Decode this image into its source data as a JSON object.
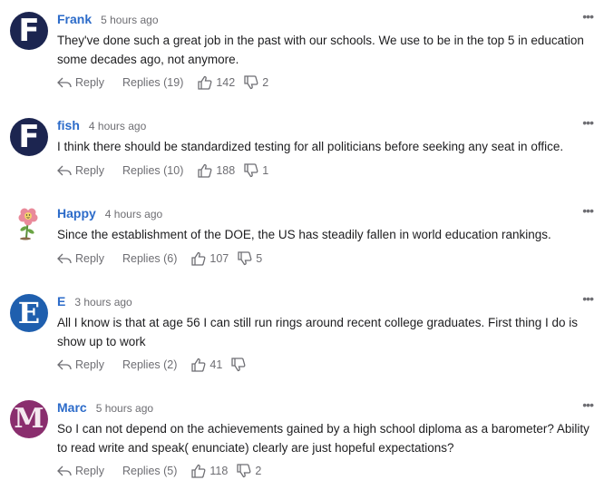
{
  "comments": [
    {
      "username": "Frank",
      "timestamp": "5 hours ago",
      "avatar_letter": "F",
      "text": "They've done such a great job in the past with our schools. We use to be in the top 5 in education some decades ago, not anymore.",
      "reply_label": "Reply",
      "replies_label": "Replies (19)",
      "upvotes": "142",
      "downvotes": "2"
    },
    {
      "username": "fish",
      "timestamp": "4 hours ago",
      "avatar_letter": "F",
      "text": "I think there should be standardized testing for all politicians before seeking any seat in office.",
      "reply_label": "Reply",
      "replies_label": "Replies (10)",
      "upvotes": "188",
      "downvotes": "1"
    },
    {
      "username": "Happy",
      "timestamp": "4 hours ago",
      "avatar_letter": "",
      "text": "Since the establishment of the DOE, the US has steadily fallen in world education rankings.",
      "reply_label": "Reply",
      "replies_label": "Replies (6)",
      "upvotes": "107",
      "downvotes": "5"
    },
    {
      "username": "E",
      "timestamp": "3 hours ago",
      "avatar_letter": "E",
      "text": "All I know is that at age 56 I can still run rings around recent college graduates. First thing I do is show up to work",
      "reply_label": "Reply",
      "replies_label": "Replies (2)",
      "upvotes": "41",
      "downvotes": ""
    },
    {
      "username": "Marc",
      "timestamp": "5 hours ago",
      "avatar_letter": "M",
      "text": "So I can not depend on the achievements gained by a high school diploma as a barometer? Ability to read write and speak( enunciate) clearly are just hopeful expectations?",
      "reply_label": "Reply",
      "replies_label": "Replies (5)",
      "upvotes": "118",
      "downvotes": "2"
    }
  ],
  "icons": {
    "reply": "reply-arrow-icon",
    "upvote": "thumbs-up-icon",
    "downvote": "thumbs-down-icon",
    "more": "more-options-icon"
  },
  "colors": {
    "username": "#2c6bc9",
    "meta_text": "#6e6e73",
    "body_text": "#1d1d1f",
    "avatar_frank": "#1c2550",
    "avatar_e": "#1f5fae",
    "avatar_marc": "#8a2e6e"
  }
}
